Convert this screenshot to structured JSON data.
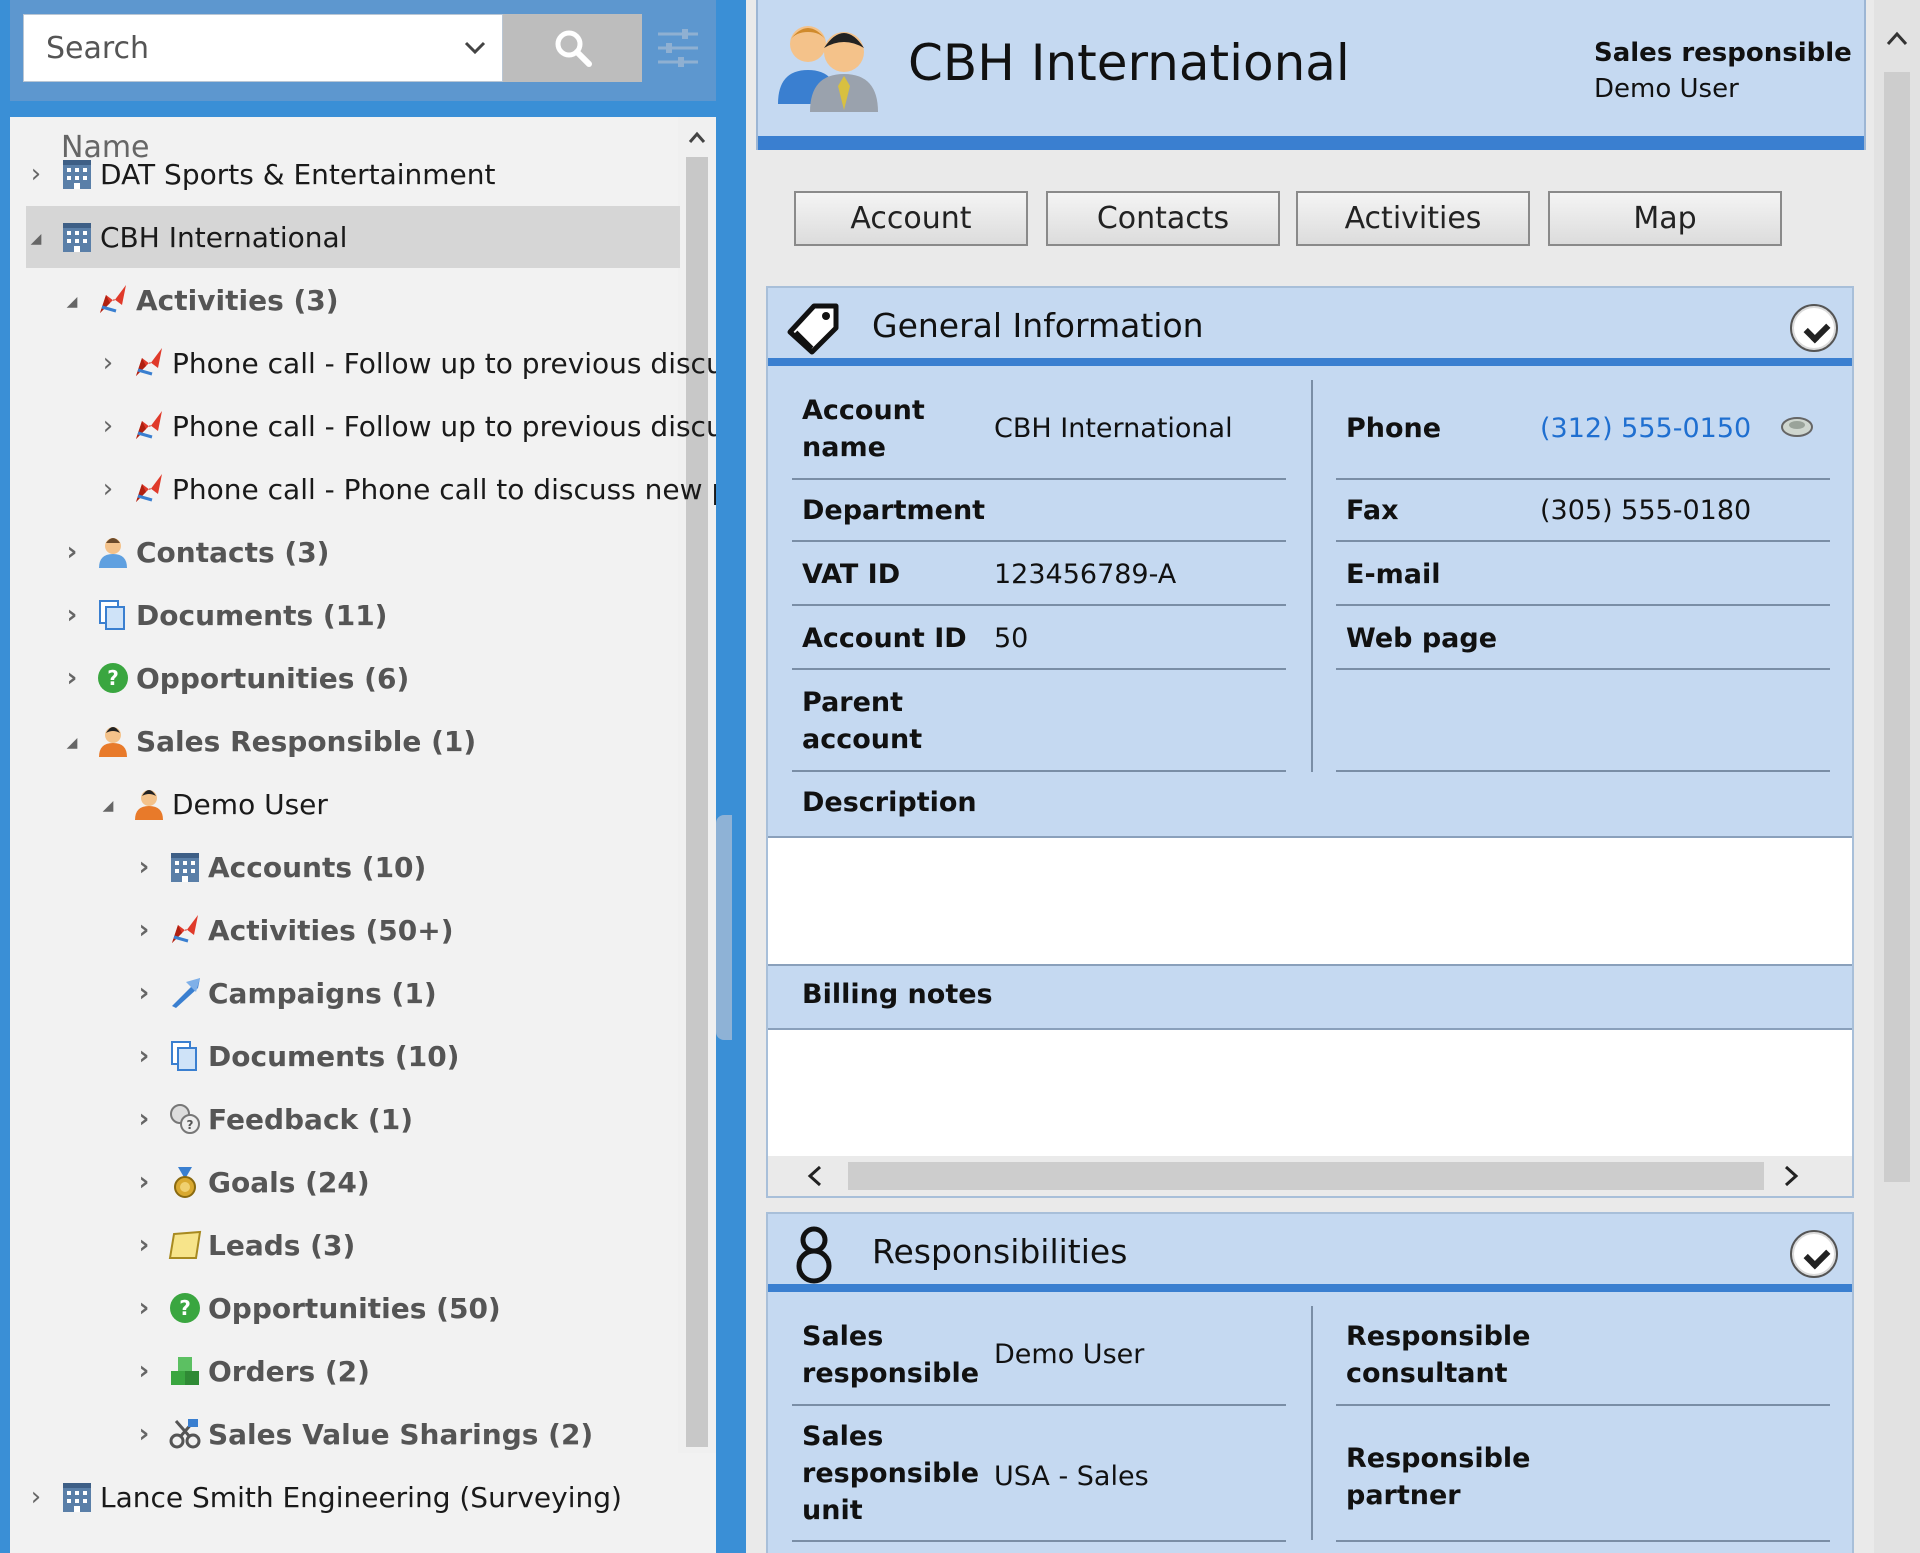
{
  "search": {
    "placeholder": "Search"
  },
  "tree": {
    "header": "Name",
    "nodes": [
      {
        "label": "DAT Sports & Entertainment",
        "icon": "building-icon",
        "expander": "›"
      },
      {
        "label": "CBH International",
        "icon": "building-icon",
        "expander": "◢"
      },
      {
        "label": "Activities (3)",
        "icon": "activity-icon",
        "expander": "◢"
      },
      {
        "label": "Phone call - Follow up to previous discu",
        "icon": "activity-icon",
        "expander": "›"
      },
      {
        "label": "Phone call - Follow up to previous discu",
        "icon": "activity-icon",
        "expander": "›"
      },
      {
        "label": "Phone call - Phone call to discuss new p",
        "icon": "activity-icon",
        "expander": "›"
      },
      {
        "label": "Contacts (3)",
        "icon": "contact-icon",
        "expander": "›"
      },
      {
        "label": "Documents (11)",
        "icon": "documents-icon",
        "expander": "›"
      },
      {
        "label": "Opportunities (6)",
        "icon": "opportunity-icon",
        "expander": "›"
      },
      {
        "label": "Sales Responsible (1)",
        "icon": "user-icon",
        "expander": "◢"
      },
      {
        "label": "Demo User",
        "icon": "user-icon",
        "expander": "◢"
      },
      {
        "label": "Accounts (10)",
        "icon": "building-icon",
        "expander": "›"
      },
      {
        "label": "Activities (50+)",
        "icon": "activity-icon",
        "expander": "›"
      },
      {
        "label": "Campaigns (1)",
        "icon": "campaign-icon",
        "expander": "›"
      },
      {
        "label": "Documents (10)",
        "icon": "documents-icon",
        "expander": "›"
      },
      {
        "label": "Feedback (1)",
        "icon": "feedback-icon",
        "expander": "›"
      },
      {
        "label": "Goals (24)",
        "icon": "medal-icon",
        "expander": "›"
      },
      {
        "label": "Leads (3)",
        "icon": "lead-icon",
        "expander": "›"
      },
      {
        "label": "Opportunities (50)",
        "icon": "opportunity-icon",
        "expander": "›"
      },
      {
        "label": "Orders (2)",
        "icon": "orders-icon",
        "expander": "›"
      },
      {
        "label": "Sales Value Sharings (2)",
        "icon": "sharing-icon",
        "expander": "›"
      },
      {
        "label": "Lance Smith Engineering (Surveying)",
        "icon": "building-icon",
        "expander": "›"
      }
    ]
  },
  "header": {
    "title": "CBH International",
    "sales_responsible_label": "Sales responsible",
    "sales_responsible_value": "Demo User"
  },
  "tabs": [
    "Account",
    "Contacts",
    "Activities",
    "Map"
  ],
  "general": {
    "title": "General Information",
    "left": [
      {
        "label": "Account name",
        "value": "CBH International"
      },
      {
        "label": "Department",
        "value": ""
      },
      {
        "label": "VAT ID",
        "value": "123456789-A"
      },
      {
        "label": "Account ID",
        "value": "50"
      },
      {
        "label": "Parent account",
        "value": ""
      }
    ],
    "right": [
      {
        "label": "Phone",
        "value": "(312) 555-0150"
      },
      {
        "label": "Fax",
        "value": "(305) 555-0180"
      },
      {
        "label": "E-mail",
        "value": ""
      },
      {
        "label": "Web page",
        "value": ""
      }
    ],
    "description_label": "Description",
    "billing_label": "Billing notes"
  },
  "responsibilities": {
    "title": "Responsibilities",
    "left": [
      {
        "label": "Sales responsible",
        "value": "Demo User"
      },
      {
        "label": "Sales responsible unit",
        "value": "USA - Sales"
      }
    ],
    "right": [
      {
        "label": "Responsible consultant",
        "value": ""
      },
      {
        "label": "Responsible partner",
        "value": ""
      }
    ]
  },
  "colors": {
    "accent": "#3a7fd0",
    "panel": "#c5d9f1",
    "link": "#1f6fd0"
  }
}
